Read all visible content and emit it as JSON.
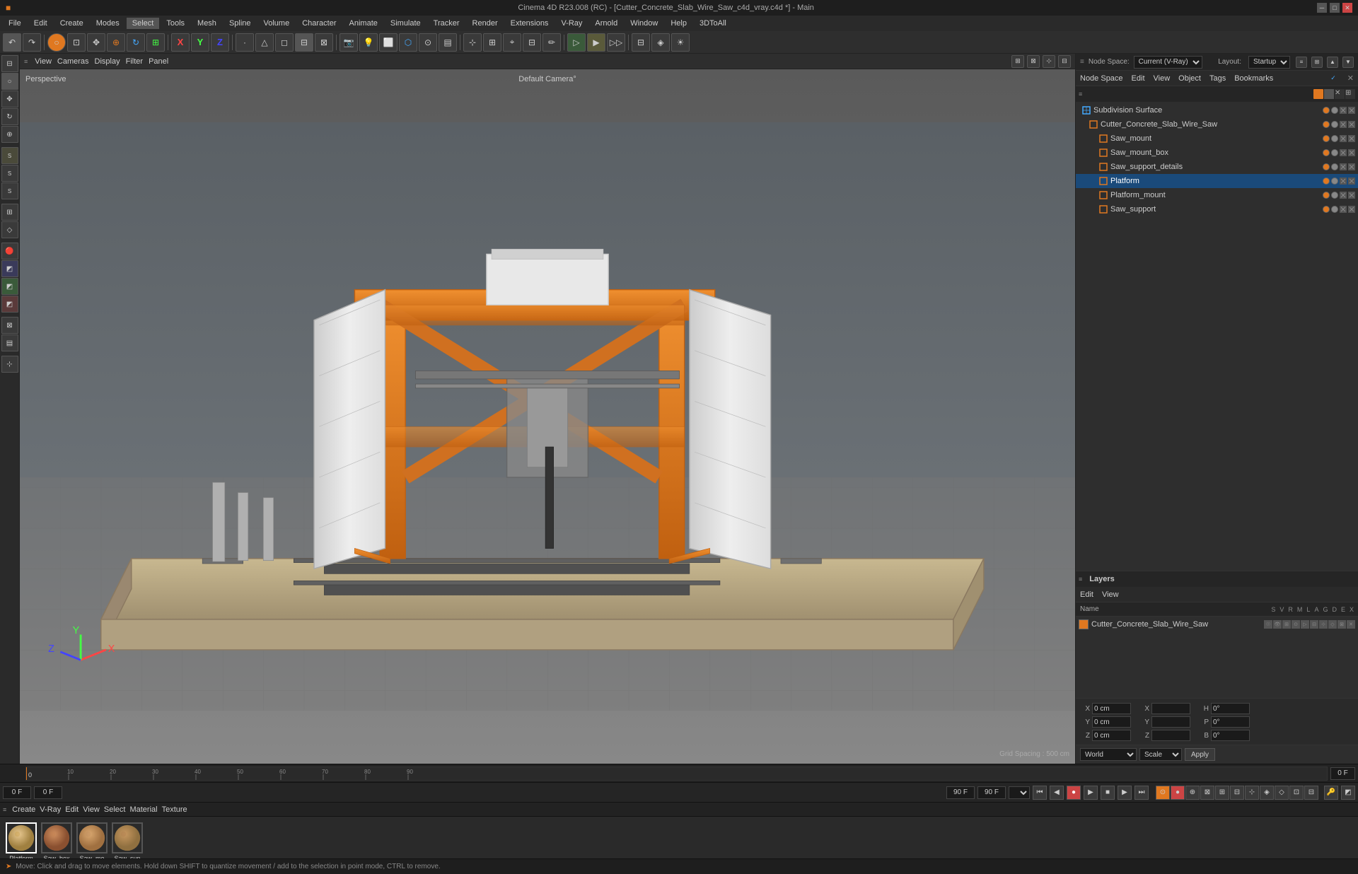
{
  "app": {
    "title": "Cinema 4D R23.008 (RC) - [Cutter_Concrete_Slab_Wire_Saw_c4d_vray.c4d *] - Main",
    "win_controls": [
      "minimize",
      "maximize",
      "close"
    ]
  },
  "menubar": {
    "items": [
      "File",
      "Edit",
      "Create",
      "Modes",
      "Select",
      "Tools",
      "Mesh",
      "Spline",
      "Volume",
      "Character",
      "Animate",
      "Simulate",
      "Tracker",
      "Render",
      "Extensions",
      "V-Ray",
      "Arnold",
      "Window",
      "Help",
      "3DToAll"
    ]
  },
  "viewport": {
    "perspective_label": "Perspective",
    "camera_label": "Default Camera",
    "camera_suffix": "°",
    "grid_spacing": "Grid Spacing : 500 cm",
    "view_menu_items": [
      "View",
      "Cameras",
      "Display",
      "Filter",
      "Panel"
    ]
  },
  "node_space": {
    "label": "Node Space:",
    "value": "Current (V-Ray)"
  },
  "layout": {
    "label": "Layout:",
    "value": "Startup"
  },
  "object_panel": {
    "top_tabs": [
      "Node Space",
      "Edit",
      "View",
      "Object",
      "Tags",
      "Bookmarks"
    ],
    "toolbar_items": [
      "≡"
    ],
    "view_menu": [
      "View",
      "Edit",
      "View"
    ],
    "items": [
      {
        "name": "Subdivision Surface",
        "level": 0,
        "icon": "cube",
        "icon_color": "#4af",
        "selected": false,
        "has_check": true
      },
      {
        "name": "Cutter_Concrete_Slab_Wire_Saw",
        "level": 1,
        "icon": "cube",
        "icon_color": "#e07820",
        "selected": false,
        "has_check": false
      },
      {
        "name": "Saw_mount",
        "level": 2,
        "icon": "cube",
        "icon_color": "#e07820",
        "selected": false
      },
      {
        "name": "Saw_mount_box",
        "level": 2,
        "icon": "cube",
        "icon_color": "#e07820",
        "selected": false
      },
      {
        "name": "Saw_support_details",
        "level": 2,
        "icon": "cube",
        "icon_color": "#e07820",
        "selected": false
      },
      {
        "name": "Platform",
        "level": 2,
        "icon": "cube",
        "icon_color": "#e07820",
        "selected": true
      },
      {
        "name": "Platform_mount",
        "level": 2,
        "icon": "cube",
        "icon_color": "#e07820",
        "selected": false
      },
      {
        "name": "Saw_support",
        "level": 2,
        "icon": "cube",
        "icon_color": "#e07820",
        "selected": false
      }
    ]
  },
  "layers_panel": {
    "title": "Layers",
    "top_tabs": [
      "Edit",
      "View"
    ],
    "header_cols": [
      "Name",
      "S",
      "V",
      "R",
      "M",
      "L",
      "A",
      "G",
      "D",
      "E",
      "X"
    ],
    "items": [
      {
        "name": "Cutter_Concrete_Slab_Wire_Saw",
        "color": "#e07820"
      }
    ]
  },
  "timeline": {
    "start_frame": "0 F",
    "current_frame": "0 F",
    "end_frame": "90 F",
    "fps": "90 F",
    "playback_fps": "",
    "markers": []
  },
  "materials": [
    {
      "name": "Platform",
      "color_top": "#c8a060",
      "color_bottom": "#a08040"
    },
    {
      "name": "Saw_box",
      "color_top": "#b07040",
      "color_bottom": "#8a5030"
    },
    {
      "name": "Saw_mo",
      "color_top": "#c09060",
      "color_bottom": "#a07040"
    },
    {
      "name": "Saw_sup",
      "color_top": "#b08050",
      "color_bottom": "#907040"
    }
  ],
  "coordinates": {
    "x_pos": "0 cm",
    "x_size": "",
    "y_pos": "0 cm",
    "y_size": "",
    "z_pos": "0 cm",
    "z_size": "",
    "h": "0°",
    "p": "0°",
    "b": "0°",
    "coord_label": "World",
    "scale_label": "Scale",
    "apply_label": "Apply"
  },
  "statusbar": {
    "message": "Move: Click and drag to move elements. Hold down SHIFT to quantize movement / add to the selection in point mode, CTRL to remove."
  },
  "icons": {
    "undo": "↶",
    "redo": "↷",
    "new": "□",
    "open": "▣",
    "save": "💾",
    "render": "▶",
    "play": "▶",
    "stop": "■",
    "prev": "⏮",
    "next": "⏭",
    "rewind": "⏪",
    "forward": "⏩"
  }
}
